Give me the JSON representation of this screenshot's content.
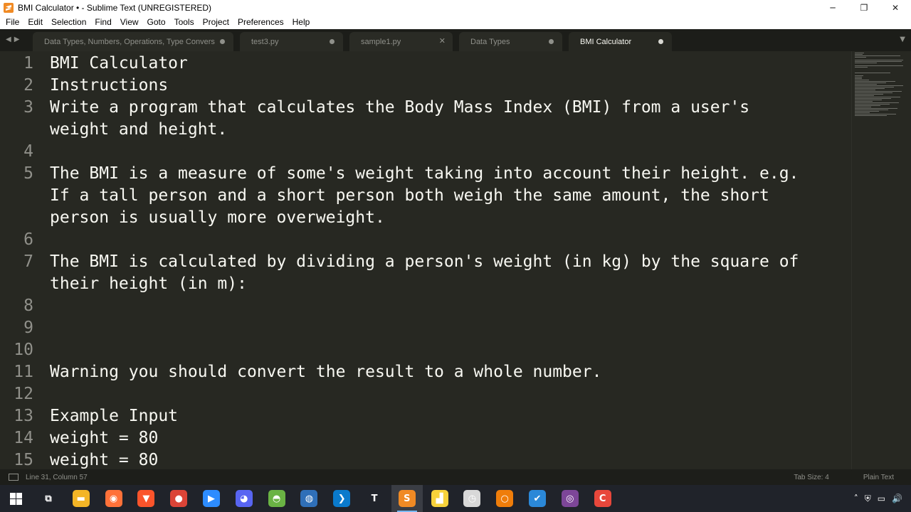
{
  "window": {
    "title": "BMI Calculator • - Sublime Text (UNREGISTERED)",
    "minimize": "─",
    "maximize": "❐",
    "close": "✕"
  },
  "menu": [
    "File",
    "Edit",
    "Selection",
    "Find",
    "View",
    "Goto",
    "Tools",
    "Project",
    "Preferences",
    "Help"
  ],
  "tabs": [
    {
      "label": "Data Types, Numbers, Operations, Type Conversion,",
      "state": "dirty"
    },
    {
      "label": "test3.py",
      "state": "dirty"
    },
    {
      "label": "sample1.py",
      "state": "close"
    },
    {
      "label": "Data Types",
      "state": "dirty"
    },
    {
      "label": "BMI Calculator",
      "state": "dirty",
      "active": true
    }
  ],
  "editor": {
    "rows": [
      {
        "num": "1",
        "text": "BMI Calculator"
      },
      {
        "num": "2",
        "text": "Instructions"
      },
      {
        "num": "3",
        "text": "Write a program that calculates the Body Mass Index (BMI) from a user's"
      },
      {
        "num": "",
        "text": "weight and height."
      },
      {
        "num": "4",
        "text": ""
      },
      {
        "num": "5",
        "text": "The BMI is a measure of some's weight taking into account their height. e.g."
      },
      {
        "num": "",
        "text": "If a tall person and a short person both weigh the same amount, the short"
      },
      {
        "num": "",
        "text": "person is usually more overweight."
      },
      {
        "num": "6",
        "text": ""
      },
      {
        "num": "7",
        "text": "The BMI is calculated by dividing a person's weight (in kg) by the square of"
      },
      {
        "num": "",
        "text": "their height (in m):"
      },
      {
        "num": "8",
        "text": ""
      },
      {
        "num": "9",
        "text": ""
      },
      {
        "num": "10",
        "text": ""
      },
      {
        "num": "11",
        "text": "Warning you should convert the result to a whole number."
      },
      {
        "num": "12",
        "text": ""
      },
      {
        "num": "13",
        "text": "Example Input"
      },
      {
        "num": "14",
        "text": "weight = 80"
      },
      {
        "num": "15",
        "text": "weight = 80"
      }
    ]
  },
  "statusbar": {
    "position": "Line 31, Column 57",
    "tab_size": "Tab Size: 4",
    "syntax": "Plain Text"
  },
  "taskbar": {
    "apps": [
      {
        "name": "task-view-icon",
        "glyph": "⧉",
        "color": "#20232a"
      },
      {
        "name": "file-explorer-icon",
        "glyph": "▬",
        "color": "#f3b526"
      },
      {
        "name": "firefox-icon",
        "glyph": "◉",
        "color": "#ff7139"
      },
      {
        "name": "brave-icon",
        "glyph": "▼",
        "color": "#fb542b"
      },
      {
        "name": "chrome-icon",
        "glyph": "●",
        "color": "#db4437"
      },
      {
        "name": "zoom-icon",
        "glyph": "▶",
        "color": "#2d8cff"
      },
      {
        "name": "discord-icon",
        "glyph": "◕",
        "color": "#5865f2"
      },
      {
        "name": "android-icon",
        "glyph": "◓",
        "color": "#6ab344"
      },
      {
        "name": "globe-icon",
        "glyph": "◍",
        "color": "#2f6fb8"
      },
      {
        "name": "vscode-icon",
        "glyph": "❯",
        "color": "#0a7acc"
      },
      {
        "name": "typora-icon",
        "glyph": "T",
        "color": "#20232a"
      },
      {
        "name": "sublime-icon",
        "glyph": "S",
        "color": "#f08a24"
      },
      {
        "name": "sticky-notes-icon",
        "glyph": "▟",
        "color": "#f7d23b"
      },
      {
        "name": "clock-icon",
        "glyph": "◷",
        "color": "#d8d8d8"
      },
      {
        "name": "search-app-icon",
        "glyph": "○",
        "color": "#ef7d0a"
      },
      {
        "name": "todo-icon",
        "glyph": "✔",
        "color": "#2b88d8"
      },
      {
        "name": "tor-icon",
        "glyph": "◎",
        "color": "#7d4698"
      },
      {
        "name": "canva-icon",
        "glyph": "C",
        "color": "#e8473b"
      }
    ],
    "tray": [
      "˄",
      "⛨",
      "▭",
      "🔊"
    ]
  }
}
